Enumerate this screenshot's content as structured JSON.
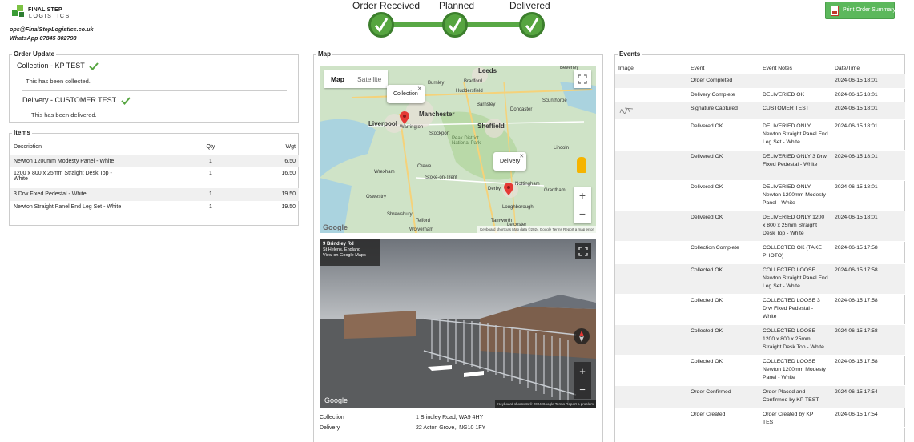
{
  "header": {
    "logo_line1": "FINAL STEP",
    "logo_line2": "LOGISTICS",
    "email": "ops@FinalStepLogistics.co.uk",
    "whatsapp": "WhatsApp 07845 802798",
    "print_label": "Print Order Summary"
  },
  "progress": {
    "steps": [
      "Order Received",
      "Planned",
      "Delivered"
    ],
    "accent": "#56a540"
  },
  "order_update": {
    "legend": "Order Update",
    "collection_title": "Collection - KP TEST",
    "collection_note": "This has been collected.",
    "delivery_title": "Delivery - CUSTOMER TEST",
    "delivery_note": "This has been delivered."
  },
  "items": {
    "legend": "Items",
    "headers": {
      "description": "Description",
      "qty": "Qty",
      "wgt": "Wgt"
    },
    "rows": [
      {
        "description": "Newton 1200mm Modesty Panel - White",
        "qty": "1",
        "wgt": "6.50"
      },
      {
        "description": "1200 x 800 x 25mm Straight Desk Top - White",
        "qty": "1",
        "wgt": "16.50"
      },
      {
        "description": "3 Drw Fixed Pedestal - White",
        "qty": "1",
        "wgt": "19.50"
      },
      {
        "description": "Newton Straight Panel End Leg Set - White",
        "qty": "1",
        "wgt": "19.50"
      }
    ]
  },
  "map": {
    "legend": "Map",
    "tab_map": "Map",
    "tab_satellite": "Satellite",
    "popup_collection": "Collection",
    "popup_delivery": "Delivery",
    "cities": {
      "leeds": "Leeds",
      "bradford": "Bradford",
      "huddersfield": "Huddersfield",
      "manchester": "Manchester",
      "liverpool": "Liverpool",
      "warrington": "Warrington",
      "stockport": "Stockport",
      "sheffield": "Sheffield",
      "peak": "Peak District National Park",
      "crewe": "Crewe",
      "stoke": "Stoke-on-Trent",
      "derby": "Derby",
      "nottingham": "Nottingham",
      "wrexham": "Wrexham",
      "oswestry": "Oswestry",
      "shrewsbury": "Shrewsbury",
      "telford": "Telford",
      "lincoln": "Lincoln",
      "grantham": "Grantham",
      "loughborough": "Loughborough",
      "leicester": "Leicester",
      "tamworth": "Tamworth",
      "wolverhampton": "Wolverham",
      "doncaster": "Doncaster",
      "barnsley": "Barnsley",
      "scunthorpe": "Scunthorpe",
      "burnley": "Burnley",
      "beverley": "Beverley"
    },
    "footer": "Keyboard shortcuts   Map data ©2024 Google   Terms   Report a map error",
    "google": "Google"
  },
  "street": {
    "road": "9 Brindley Rd",
    "area": "St Helens, England",
    "link": "View on Google Maps",
    "footer": "Keyboard shortcuts   © 2024 Google   Terms   Report a problem",
    "google": "Google"
  },
  "addresses": {
    "collection_label": "Collection",
    "collection_value": "1 Brindley Road, WA9 4HY",
    "delivery_label": "Delivery",
    "delivery_value": "22 Acton Grove,, NG10 1FY"
  },
  "events": {
    "legend": "Events",
    "headers": {
      "image": "Image",
      "event": "Event",
      "notes": "Event Notes",
      "datetime": "Date/Time"
    },
    "rows": [
      {
        "event": "Order Completed",
        "notes": "",
        "datetime": "2024-06-15 18:01"
      },
      {
        "event": "Delivery Complete",
        "notes": "DELIVERIED OK",
        "datetime": "2024-06-15 18:01"
      },
      {
        "event": "Signature Captured",
        "notes": "CUSTOMER TEST",
        "datetime": "2024-06-15 18:01"
      },
      {
        "event": "Delivered OK",
        "notes": "DELIVERIED ONLY Newton Straight Panel End Leg Set - White",
        "datetime": "2024-06-15 18:01"
      },
      {
        "event": "Delivered OK",
        "notes": "DELIVERIED ONLY 3 Drw Fixed Pedestal - White",
        "datetime": "2024-06-15 18:01"
      },
      {
        "event": "Delivered OK",
        "notes": "DELIVERIED ONLY Newton 1200mm Modesty Panel - White",
        "datetime": "2024-06-15 18:01"
      },
      {
        "event": "Delivered OK",
        "notes": "DELIVERIED ONLY 1200 x 800 x 25mm Straight Desk Top - White",
        "datetime": "2024-06-15 18:01"
      },
      {
        "event": "Collection Complete",
        "notes": "COLLECTED OK (TAKE PHOTO)",
        "datetime": "2024-06-15 17:58"
      },
      {
        "event": "Collected OK",
        "notes": "COLLECTED LOOSE Newton Straight Panel End Leg Set - White",
        "datetime": "2024-06-15 17:58"
      },
      {
        "event": "Collected OK",
        "notes": "COLLECTED LOOSE 3 Drw Fixed Pedestal - White",
        "datetime": "2024-06-15 17:58"
      },
      {
        "event": "Collected OK",
        "notes": "COLLECTED LOOSE 1200 x 800 x 25mm Straight Desk Top - White",
        "datetime": "2024-06-15 17:58"
      },
      {
        "event": "Collected OK",
        "notes": "COLLECTED LOOSE Newton 1200mm Modesty Panel - White",
        "datetime": "2024-06-15 17:58"
      },
      {
        "event": "Order Confirmed",
        "notes": "Order Placed and Confirmed by KP TEST",
        "datetime": "2024-06-15 17:54"
      },
      {
        "event": "Order Created",
        "notes": "Order Created by KP TEST",
        "datetime": "2024-06-15 17:54"
      }
    ]
  }
}
